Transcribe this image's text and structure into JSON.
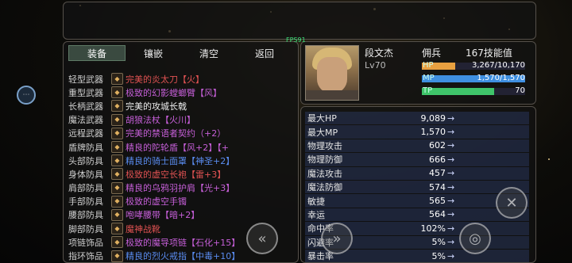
{
  "fps": "FPS91",
  "tabs": [
    "装备",
    "镶嵌",
    "清空",
    "返回"
  ],
  "equipment": [
    {
      "slot": "轻型武器",
      "item": "完美的炎太刀【火】",
      "color": "#e05252",
      "icon": "sword-icon"
    },
    {
      "slot": "重型武器",
      "item": "极致的幻影螳螂臂【风】",
      "color": "#c65fd8",
      "icon": "sword-icon"
    },
    {
      "slot": "长柄武器",
      "item": "完美的攻城长戟",
      "color": "#f0f0f0",
      "icon": "spear-icon"
    },
    {
      "slot": "魔法武器",
      "item": "胡狼法杖【火川】",
      "color": "#c65fd8",
      "icon": "staff-icon"
    },
    {
      "slot": "远程武器",
      "item": "完美的禁语者契约（+2）",
      "color": "#c65fd8",
      "icon": "bow-icon"
    },
    {
      "slot": "盾牌防具",
      "item": "精良的陀轮盾【风+2】【+",
      "color": "#c65fd8",
      "icon": "shield-icon"
    },
    {
      "slot": "头部防具",
      "item": "精良的骑士面罩【神圣+2】",
      "color": "#5a8cf0",
      "icon": "helmet-icon"
    },
    {
      "slot": "身体防具",
      "item": "极致的虚空长袍【雷+3】",
      "color": "#e05252",
      "icon": "robe-icon"
    },
    {
      "slot": "肩部防具",
      "item": "精良的乌鸦羽护肩【光+3】",
      "color": "#c65fd8",
      "icon": "shoulder-icon"
    },
    {
      "slot": "手部防具",
      "item": "极致的虚空手镯",
      "color": "#c65fd8",
      "icon": "bracer-icon"
    },
    {
      "slot": "腰部防具",
      "item": "咆哮腰带【暗+2】",
      "color": "#c65fd8",
      "icon": "belt-icon"
    },
    {
      "slot": "脚部防具",
      "item": "魔神战靴",
      "color": "#e05252",
      "icon": "boots-icon"
    },
    {
      "slot": "项链饰品",
      "item": "极致的魔导项链【石化+15】",
      "color": "#c65fd8",
      "icon": "necklace-icon"
    },
    {
      "slot": "指环饰品",
      "item": "精良的烈火戒指【中毒+10】",
      "color": "#5a8cf0",
      "icon": "ring-icon"
    }
  ],
  "character": {
    "name": "段文杰",
    "level": "Lv70",
    "role": "佣兵",
    "skill_points": "167技能值",
    "hp": {
      "label": "HP",
      "value": "3,267/10,170",
      "fraction": 0.321,
      "color": "#e8a040"
    },
    "mp": {
      "label": "MP",
      "value": "1,570/1,570",
      "fraction": 1.0,
      "color": "#3f8fe0"
    },
    "tp": {
      "label": "TP",
      "value": "70",
      "fraction": 0.7,
      "color": "#3fc46a"
    }
  },
  "stats": [
    {
      "name": "最大HP",
      "value": "9,089"
    },
    {
      "name": "最大MP",
      "value": "1,570"
    },
    {
      "name": "物理攻击",
      "value": "602"
    },
    {
      "name": "物理防御",
      "value": "666"
    },
    {
      "name": "魔法攻击",
      "value": "457"
    },
    {
      "name": "魔法防御",
      "value": "574"
    },
    {
      "name": "敏捷",
      "value": "565"
    },
    {
      "name": "幸运",
      "value": "564"
    },
    {
      "name": "命中率",
      "value": "102%"
    },
    {
      "name": "闪避率",
      "value": "5%"
    },
    {
      "name": "暴击率",
      "value": "5%"
    }
  ],
  "stat_arrow": "→",
  "controls": {
    "menu": "⋯",
    "back": "«",
    "forward": "»",
    "action": "◎",
    "close": "✕"
  }
}
